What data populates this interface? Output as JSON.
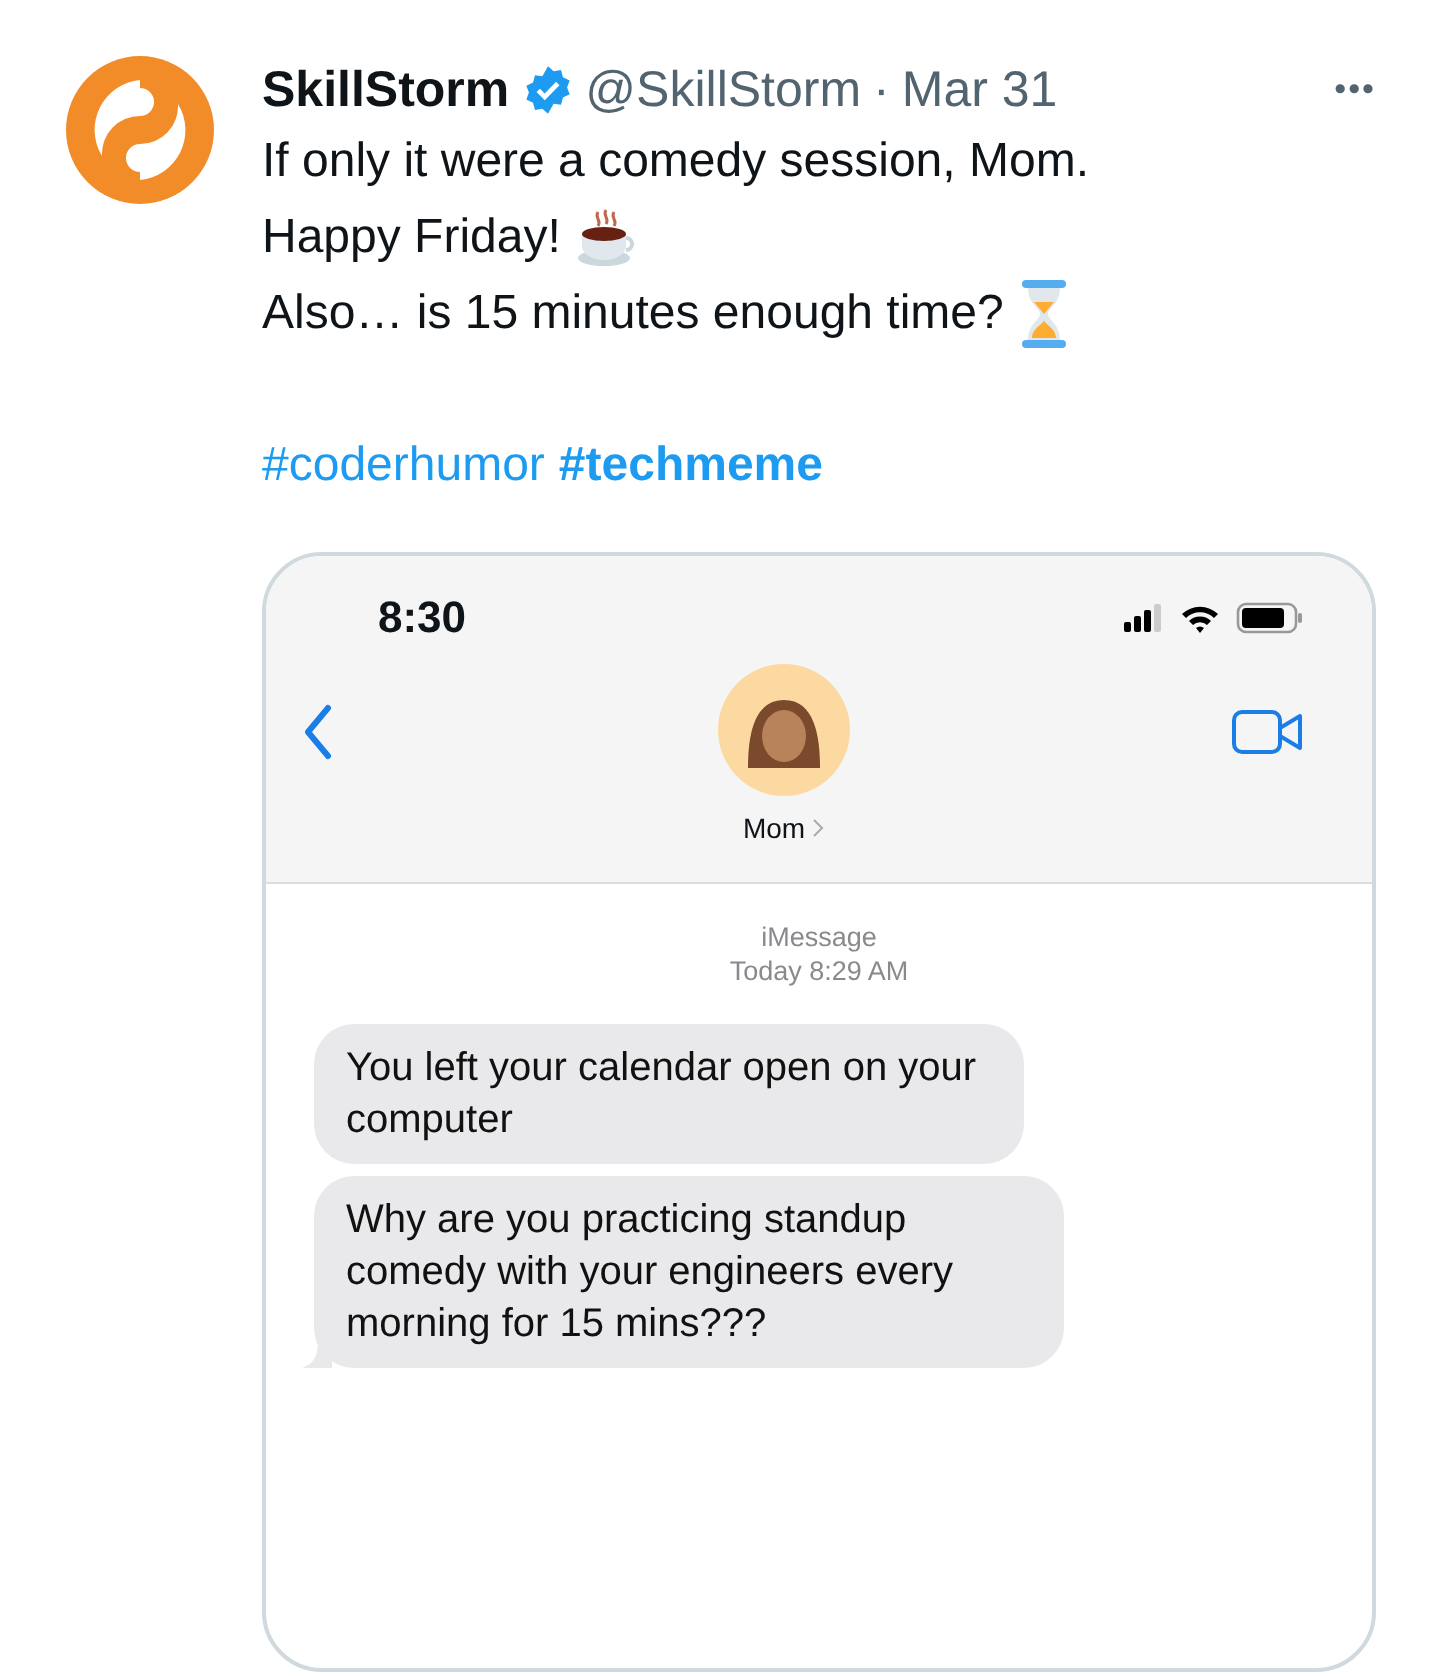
{
  "tweet": {
    "author": "SkillStorm",
    "verified": true,
    "handle": "@SkillStorm",
    "separator": "·",
    "date": "Mar 31",
    "more": "•••",
    "lines": [
      {
        "text": "If only it were a comedy session, Mom.",
        "kind": "plain"
      },
      {
        "text": "Happy Friday!",
        "kind": "coffee"
      },
      {
        "text": "Also… is 15 minutes enough time?",
        "kind": "hourglass"
      }
    ],
    "hashtags": [
      {
        "text": "#coderhumor",
        "bold": false
      },
      {
        "text": "#techmeme",
        "bold": true
      }
    ]
  },
  "phone": {
    "time": "8:30",
    "contact": "Mom",
    "service": "iMessage",
    "timestamp": "Today 8:29 AM",
    "messages": [
      {
        "text": "You left your calendar open on your computer",
        "tail": false
      },
      {
        "text": "Why are you practicing standup comedy with your engineers every morning for 15 mins???",
        "tail": true
      }
    ]
  }
}
